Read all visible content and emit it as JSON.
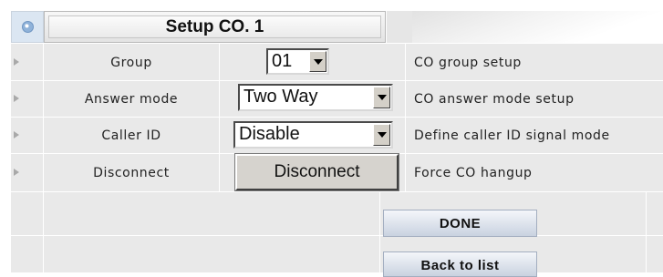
{
  "header": {
    "title": "Setup CO. 1",
    "icon": "expand-icon"
  },
  "rows": [
    {
      "label": "Group",
      "control": "select",
      "value": "01",
      "description": "CO group setup"
    },
    {
      "label": "Answer mode",
      "control": "select",
      "value": "Two Way",
      "description": "CO answer mode setup"
    },
    {
      "label": "Caller ID",
      "control": "select",
      "value": "Disable",
      "description": "Define caller ID signal mode"
    },
    {
      "label": "Disconnect",
      "control": "button",
      "value": "Disconnect",
      "description": "Force CO hangup"
    }
  ],
  "actions": {
    "done": "DONE",
    "back": "Back to list"
  },
  "colors": {
    "grid": "#e9e9e9",
    "header_icon_bg": "#dbe6f2",
    "action_button": "#c9d2e0"
  }
}
